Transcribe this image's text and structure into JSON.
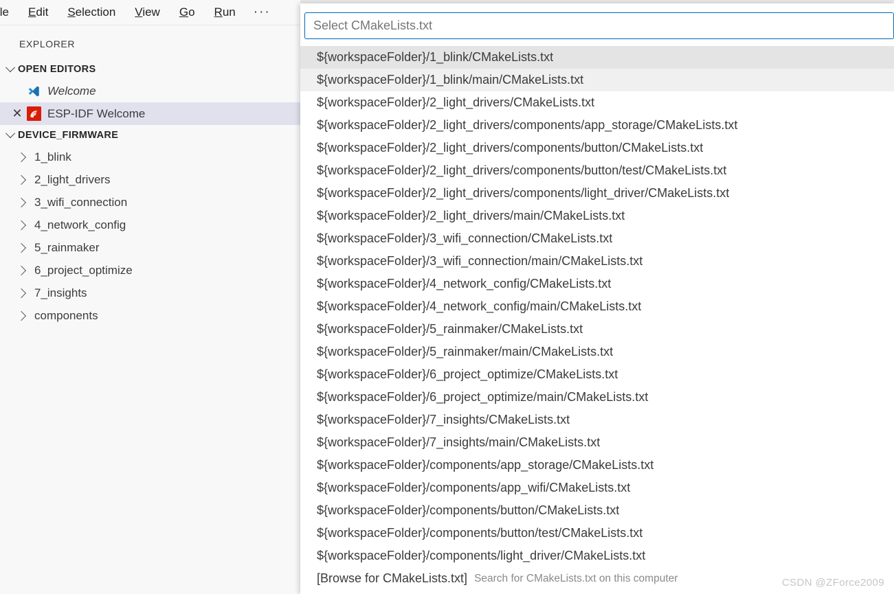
{
  "menubar": {
    "items": [
      {
        "label": "ile",
        "mnemonic": ""
      },
      {
        "label": "Edit",
        "mnemonic": "E"
      },
      {
        "label": "Selection",
        "mnemonic": "S"
      },
      {
        "label": "View",
        "mnemonic": "V"
      },
      {
        "label": "Go",
        "mnemonic": "G"
      },
      {
        "label": "Run",
        "mnemonic": "R"
      }
    ],
    "more_label": "···"
  },
  "sidebar": {
    "title": "EXPLORER",
    "open_editors": {
      "header": "OPEN EDITORS",
      "items": [
        {
          "label": "Welcome",
          "icon": "vscode-logo-icon",
          "selected": false,
          "closable": false
        },
        {
          "label": "ESP-IDF Welcome",
          "icon": "esp-idf-logo-icon",
          "selected": true,
          "closable": true
        }
      ]
    },
    "workspace": {
      "header": "DEVICE_FIRMWARE",
      "folders": [
        {
          "label": "1_blink"
        },
        {
          "label": "2_light_drivers"
        },
        {
          "label": "3_wifi_connection"
        },
        {
          "label": "4_network_config"
        },
        {
          "label": "5_rainmaker"
        },
        {
          "label": "6_project_optimize"
        },
        {
          "label": "7_insights"
        },
        {
          "label": "components"
        }
      ]
    }
  },
  "quickpick": {
    "input_value": "",
    "input_placeholder": "Select CMakeLists.txt",
    "items": [
      {
        "label": "${workspaceFolder}/1_blink/CMakeLists.txt",
        "desc": "",
        "state": "active"
      },
      {
        "label": "${workspaceFolder}/1_blink/main/CMakeLists.txt",
        "desc": "",
        "state": "hover"
      },
      {
        "label": "${workspaceFolder}/2_light_drivers/CMakeLists.txt",
        "desc": "",
        "state": ""
      },
      {
        "label": "${workspaceFolder}/2_light_drivers/components/app_storage/CMakeLists.txt",
        "desc": "",
        "state": ""
      },
      {
        "label": "${workspaceFolder}/2_light_drivers/components/button/CMakeLists.txt",
        "desc": "",
        "state": ""
      },
      {
        "label": "${workspaceFolder}/2_light_drivers/components/button/test/CMakeLists.txt",
        "desc": "",
        "state": ""
      },
      {
        "label": "${workspaceFolder}/2_light_drivers/components/light_driver/CMakeLists.txt",
        "desc": "",
        "state": ""
      },
      {
        "label": "${workspaceFolder}/2_light_drivers/main/CMakeLists.txt",
        "desc": "",
        "state": ""
      },
      {
        "label": "${workspaceFolder}/3_wifi_connection/CMakeLists.txt",
        "desc": "",
        "state": ""
      },
      {
        "label": "${workspaceFolder}/3_wifi_connection/main/CMakeLists.txt",
        "desc": "",
        "state": ""
      },
      {
        "label": "${workspaceFolder}/4_network_config/CMakeLists.txt",
        "desc": "",
        "state": ""
      },
      {
        "label": "${workspaceFolder}/4_network_config/main/CMakeLists.txt",
        "desc": "",
        "state": ""
      },
      {
        "label": "${workspaceFolder}/5_rainmaker/CMakeLists.txt",
        "desc": "",
        "state": ""
      },
      {
        "label": "${workspaceFolder}/5_rainmaker/main/CMakeLists.txt",
        "desc": "",
        "state": ""
      },
      {
        "label": "${workspaceFolder}/6_project_optimize/CMakeLists.txt",
        "desc": "",
        "state": ""
      },
      {
        "label": "${workspaceFolder}/6_project_optimize/main/CMakeLists.txt",
        "desc": "",
        "state": ""
      },
      {
        "label": "${workspaceFolder}/7_insights/CMakeLists.txt",
        "desc": "",
        "state": ""
      },
      {
        "label": "${workspaceFolder}/7_insights/main/CMakeLists.txt",
        "desc": "",
        "state": ""
      },
      {
        "label": "${workspaceFolder}/components/app_storage/CMakeLists.txt",
        "desc": "",
        "state": ""
      },
      {
        "label": "${workspaceFolder}/components/app_wifi/CMakeLists.txt",
        "desc": "",
        "state": ""
      },
      {
        "label": "${workspaceFolder}/components/button/CMakeLists.txt",
        "desc": "",
        "state": ""
      },
      {
        "label": "${workspaceFolder}/components/button/test/CMakeLists.txt",
        "desc": "",
        "state": ""
      },
      {
        "label": "${workspaceFolder}/components/light_driver/CMakeLists.txt",
        "desc": "",
        "state": ""
      },
      {
        "label": "[Browse for CMakeLists.txt]",
        "desc": "Search for CMakeLists.txt on this computer",
        "state": ""
      }
    ]
  },
  "watermark": "CSDN @ZForce2009",
  "colors": {
    "accent_border": "#0066b8",
    "selected_row": "#e1e1ee",
    "active_row": "#e4e4e4",
    "esp_red": "#d81e06",
    "vscode_blue": "#0f6fbd"
  }
}
